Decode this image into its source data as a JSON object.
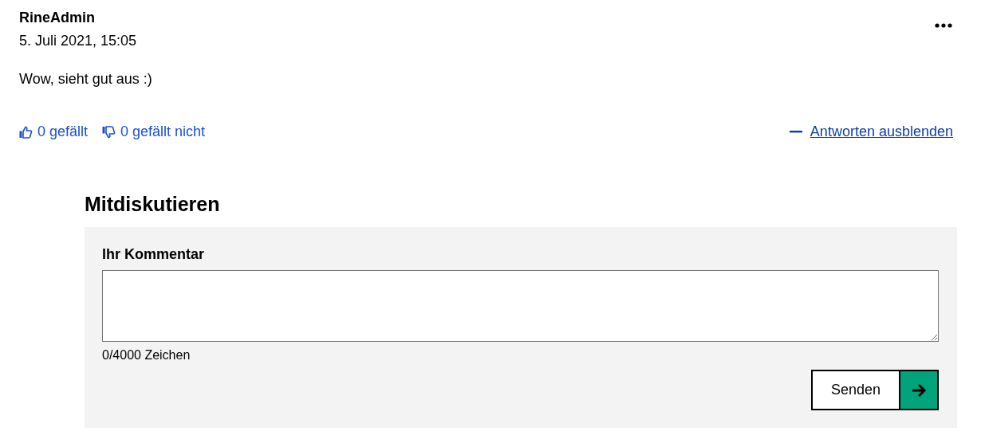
{
  "comment": {
    "author": "RineAdmin",
    "date": "5. Juli 2021, 15:05",
    "text": "Wow, sieht gut aus :)",
    "likes": "0 gefällt",
    "dislikes": "0 gefällt nicht",
    "toggle_replies": "Antworten ausblenden"
  },
  "reply_form": {
    "heading": "Mitdiskutieren",
    "field_label": "Ihr Kommentar",
    "counter": "0/4000 Zeichen",
    "submit": "Senden"
  }
}
